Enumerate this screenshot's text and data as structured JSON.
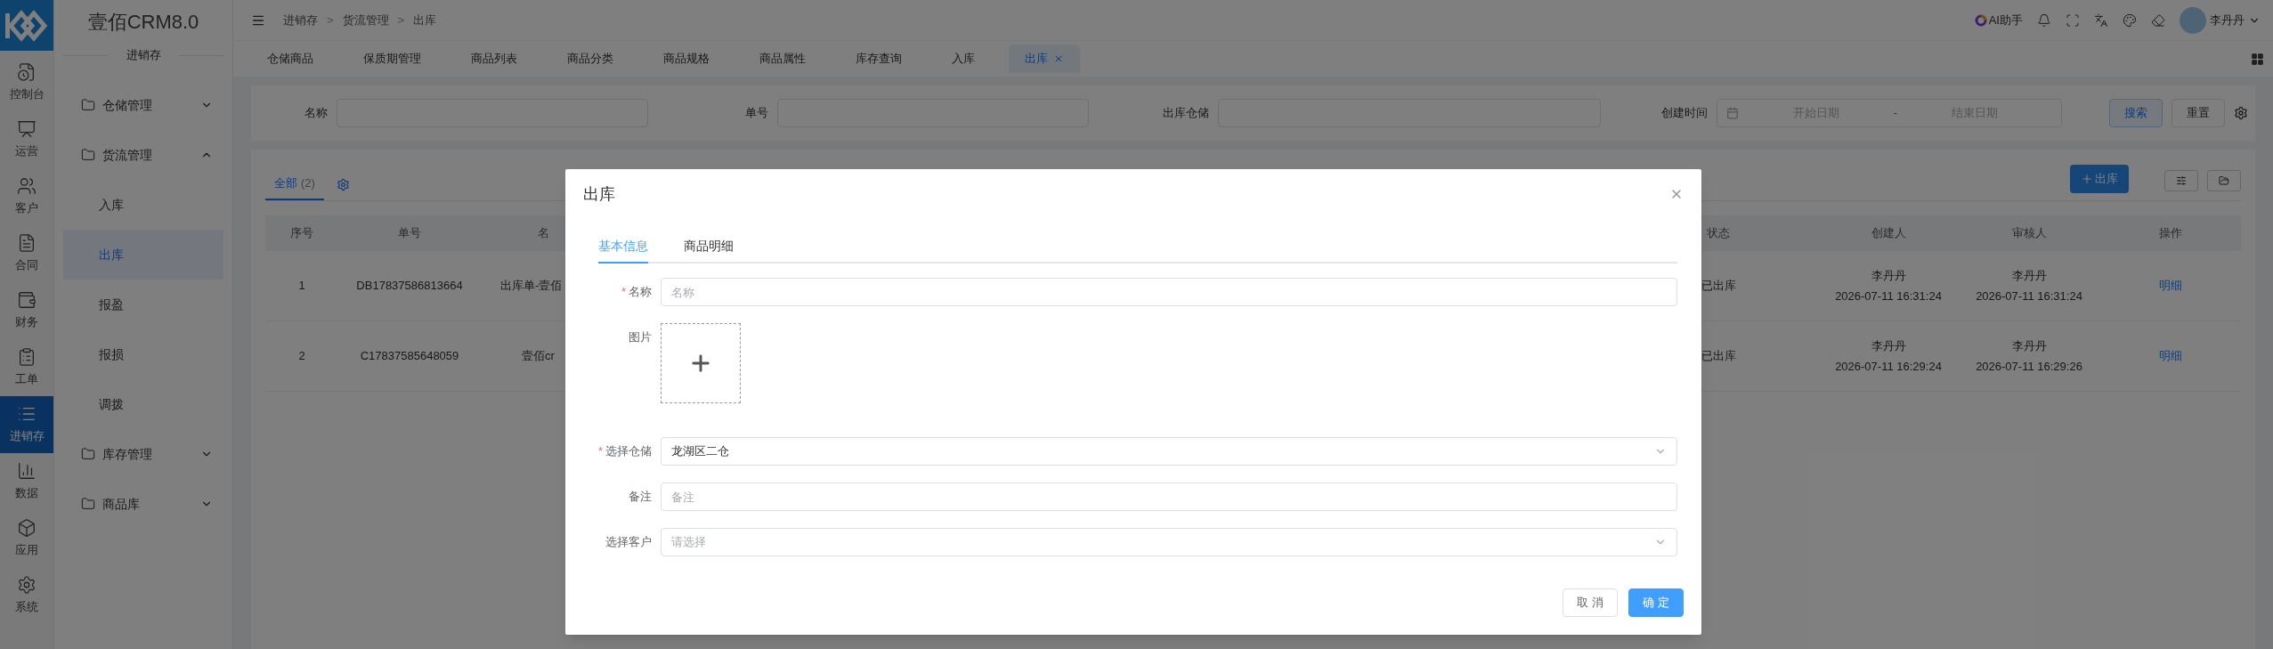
{
  "rail": {
    "items": [
      {
        "label": "控制台",
        "selected": false
      },
      {
        "label": "运营",
        "selected": false
      },
      {
        "label": "客户",
        "selected": false
      },
      {
        "label": "合同",
        "selected": false
      },
      {
        "label": "财务",
        "selected": false
      },
      {
        "label": "工单",
        "selected": false
      },
      {
        "label": "进销存",
        "selected": true
      },
      {
        "label": "数据",
        "selected": false
      },
      {
        "label": "应用",
        "selected": false
      },
      {
        "label": "系统",
        "selected": false
      }
    ]
  },
  "sidebar": {
    "title": "壹佰CRM8.0",
    "section": "进销存",
    "items": [
      {
        "label": "仓储管理",
        "expanded": false
      },
      {
        "label": "货流管理",
        "expanded": true,
        "children": [
          {
            "label": "入库",
            "selected": false
          },
          {
            "label": "出库",
            "selected": true
          },
          {
            "label": "报盈",
            "selected": false
          },
          {
            "label": "报损",
            "selected": false
          },
          {
            "label": "调拨",
            "selected": false
          }
        ]
      },
      {
        "label": "库存管理",
        "expanded": false
      },
      {
        "label": "商品库",
        "expanded": false
      }
    ]
  },
  "breadcrumb": {
    "separator": ">",
    "items": [
      "进销存",
      "货流管理",
      "出库"
    ]
  },
  "header": {
    "ai_label": "AI助手",
    "user": "李丹丹"
  },
  "page_tabs": [
    {
      "label": "仓储商品",
      "selected": false
    },
    {
      "label": "保质期管理",
      "selected": false
    },
    {
      "label": "商品列表",
      "selected": false
    },
    {
      "label": "商品分类",
      "selected": false
    },
    {
      "label": "商品规格",
      "selected": false
    },
    {
      "label": "商品属性",
      "selected": false
    },
    {
      "label": "库存查询",
      "selected": false
    },
    {
      "label": "入库",
      "selected": false
    },
    {
      "label": "出库",
      "selected": true
    }
  ],
  "filters": [
    {
      "kind": "text",
      "label": "名称"
    },
    {
      "kind": "text",
      "label": "单号"
    },
    {
      "kind": "text",
      "label": "出库仓储"
    },
    {
      "kind": "date_range",
      "label": "创建时间",
      "start_placeholder": "开始日期",
      "separator": "-",
      "end_placeholder": "结束日期"
    }
  ],
  "filter_buttons": [
    {
      "label": "搜索",
      "primary": true
    },
    {
      "label": "重置",
      "primary": false
    }
  ],
  "list_tabs": [
    {
      "label": "全部",
      "count": "(2)",
      "selected": true
    }
  ],
  "add_button": "出库",
  "table": {
    "columns": [
      "序号",
      "单号",
      "名",
      "状态",
      "创建人",
      "审核人",
      "操作"
    ],
    "rows": [
      {
        "index": "1",
        "number": "DB17837586813664",
        "name": "出库单-壹佰",
        "status": "已出库",
        "creator": "李丹丹",
        "created": "2026-07-11 16:31:24",
        "reviewer": "李丹丹",
        "reviewed": "2026-07-11 16:31:24",
        "action": "明细"
      },
      {
        "index": "2",
        "number": "C17837585648059",
        "name": "壹佰cr",
        "status": "已出库",
        "creator": "李丹丹",
        "created": "2026-07-11 16:29:24",
        "reviewer": "李丹丹",
        "reviewed": "2026-07-11 16:29:26",
        "action": "明细"
      }
    ]
  },
  "dialog": {
    "title": "出库",
    "tabs": [
      {
        "label": "基本信息",
        "selected": true
      },
      {
        "label": "商品明细",
        "selected": false
      }
    ],
    "fields": [
      {
        "kind": "text",
        "label": "名称",
        "required_mark": "*",
        "placeholder": "名称"
      },
      {
        "kind": "upload",
        "label": "图片"
      },
      {
        "kind": "select",
        "label": "选择仓储",
        "required_mark": "*",
        "value": "龙湖区二仓"
      },
      {
        "kind": "text",
        "label": "备注",
        "placeholder": "备注"
      },
      {
        "kind": "select",
        "label": "选择客户",
        "placeholder": "请选择"
      }
    ],
    "buttons": [
      {
        "label": "取消",
        "primary": false
      },
      {
        "label": "确定",
        "primary": true
      }
    ]
  }
}
